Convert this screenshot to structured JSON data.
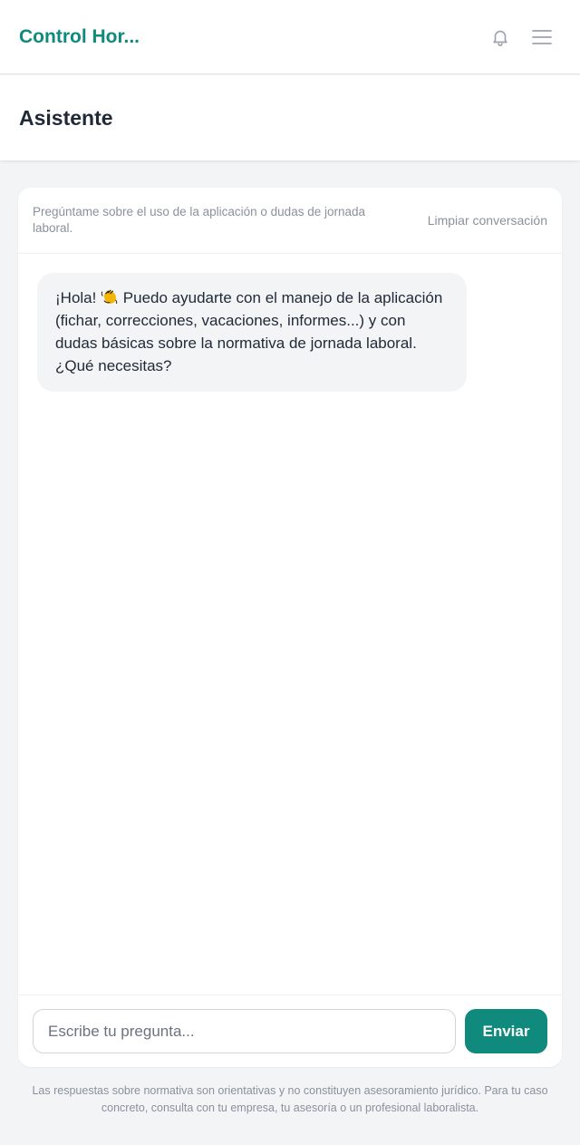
{
  "app": {
    "title": "Control Hor..."
  },
  "header": {
    "title": "Asistente"
  },
  "chat": {
    "intro": "Pregúntame sobre el uso de la aplicación o dudas de jornada laboral.",
    "clear_label": "Limpiar conversación",
    "messages": [
      {
        "role": "assistant",
        "text_before_emoji": "¡Hola! ",
        "emoji_icon": "waving-hand-icon",
        "text_after_emoji": " Puedo ayudarte con el manejo de la aplicación (fichar, correcciones, vacaciones, informes...) y con dudas básicas sobre la normativa de jornada laboral. ¿Qué necesitas?"
      }
    ],
    "input": {
      "placeholder": "Escribe tu pregunta...",
      "value": ""
    },
    "send_label": "Enviar"
  },
  "disclaimer": "Las respuestas sobre normativa son orientativas y no constituyen asesoramiento jurídico. Para tu caso concreto, consulta con tu empresa, tu asesoría o un profesional laboralista.",
  "icons": {
    "notifications": "bell-icon",
    "menu": "hamburger-menu-icon"
  },
  "colors": {
    "brand": "#0f8a7c",
    "muted_text": "#8a919c",
    "bubble_bg": "#f3f4f6",
    "page_bg": "#f3f4f6"
  }
}
